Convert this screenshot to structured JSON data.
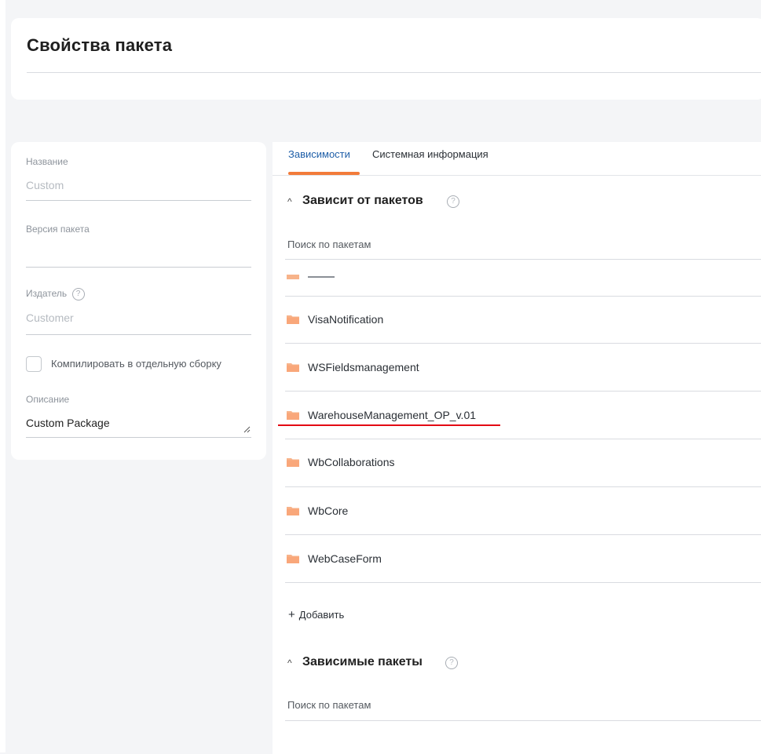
{
  "header": {
    "title": "Свойства пакета"
  },
  "left_panel": {
    "name_label": "Название",
    "name_value": "Custom",
    "version_label": "Версия пакета",
    "version_value": "",
    "publisher_label": "Издатель",
    "publisher_value": "Customer",
    "compile_label": "Компилировать в отдельную сборку",
    "compile_checked": false,
    "description_label": "Описание",
    "description_value": "Custom Package"
  },
  "tabs": [
    {
      "label": "Зависимости",
      "active": true
    },
    {
      "label": "Системная информация",
      "active": false
    }
  ],
  "depends_on": {
    "toggle": "^",
    "title": "Зависит от пакетов",
    "search_label": "Поиск по пакетам",
    "packages": [
      "VisaNotification",
      "WSFieldsmanagement",
      "WarehouseManagement_OP_v.01",
      "WbCollaborations",
      "WbCore",
      "WebCaseForm"
    ],
    "add_label": "Добавить"
  },
  "dependents": {
    "toggle": "^",
    "title": "Зависимые пакеты",
    "search_label": "Поиск по пакетам"
  },
  "help_glyph": "?",
  "colors": {
    "accent_orange": "#f27b3a",
    "folder": "#f7b38a",
    "highlight_red": "#e30613",
    "tab_active": "#1f5fa8"
  }
}
